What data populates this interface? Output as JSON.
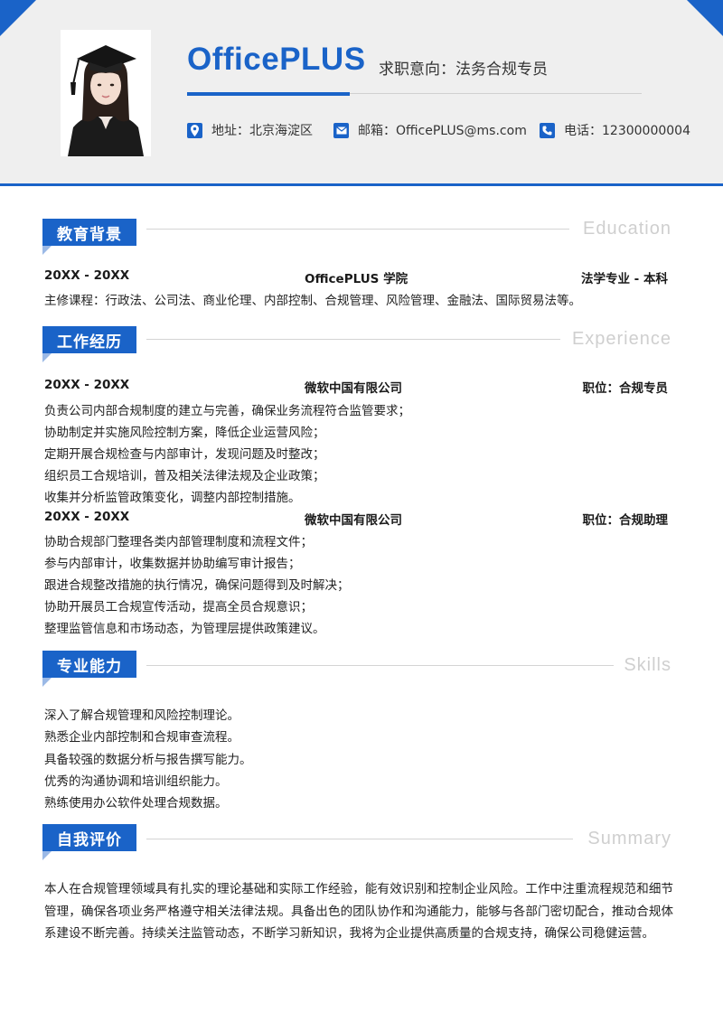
{
  "header": {
    "name": "OfficePLUS",
    "job_intent": "求职意向：法务合规专员",
    "contacts": [
      {
        "icon": "location-icon",
        "text": "地址：北京海淀区"
      },
      {
        "icon": "mail-icon",
        "text": "邮箱：OfficePLUS@ms.com"
      },
      {
        "icon": "phone-icon",
        "text": "电话：12300000004"
      }
    ]
  },
  "sections": {
    "education": {
      "title": "教育背景",
      "title_en": "Education",
      "entry": {
        "period": "20XX - 20XX",
        "school": "OfficePLUS 学院",
        "major": "法学专业 - 本科"
      },
      "courses": "主修课程：行政法、公司法、商业伦理、内部控制、合规管理、风险管理、金融法、国际贸易法等。"
    },
    "work": {
      "title": "工作经历",
      "title_en": "Experience",
      "jobs": [
        {
          "period": "20XX - 20XX",
          "company": "微软中国有限公司",
          "position": "职位：合规专员",
          "duties": [
            "负责公司内部合规制度的建立与完善，确保业务流程符合监管要求；",
            "协助制定并实施风险控制方案，降低企业运营风险；",
            "定期开展合规检查与内部审计，发现问题及时整改；",
            "组织员工合规培训，普及相关法律法规及企业政策；",
            "收集并分析监管政策变化，调整内部控制措施。"
          ]
        },
        {
          "period": "20XX - 20XX",
          "company": "微软中国有限公司",
          "position": "职位：合规助理",
          "duties": [
            "协助合规部门整理各类内部管理制度和流程文件；",
            "参与内部审计，收集数据并协助编写审计报告；",
            "跟进合规整改措施的执行情况，确保问题得到及时解决；",
            "协助开展员工合规宣传活动，提高全员合规意识；",
            "整理监管信息和市场动态，为管理层提供政策建议。"
          ]
        }
      ]
    },
    "skills": {
      "title": "专业能力",
      "title_en": "Skills",
      "items": [
        "深入了解合规管理和风险控制理论。",
        "熟悉企业内部控制和合规审查流程。",
        "具备较强的数据分析与报告撰写能力。",
        "优秀的沟通协调和培训组织能力。",
        "熟练使用办公软件处理合规数据。"
      ]
    },
    "summary": {
      "title": "自我评价",
      "title_en": "Summary",
      "text": "本人在合规管理领域具有扎实的理论基础和实际工作经验，能有效识别和控制企业风险。工作中注重流程规范和细节管理，确保各项业务严格遵守相关法律法规。具备出色的团队协作和沟通能力，能够与各部门密切配合，推动合规体系建设不断完善。持续关注监管动态，不断学习新知识，我将为企业提供高质量的合规支持，确保公司稳健运营。"
    }
  },
  "colors": {
    "accent": "#1a63c8",
    "header_bg": "#efefef",
    "tab": "#9bb9e6"
  }
}
